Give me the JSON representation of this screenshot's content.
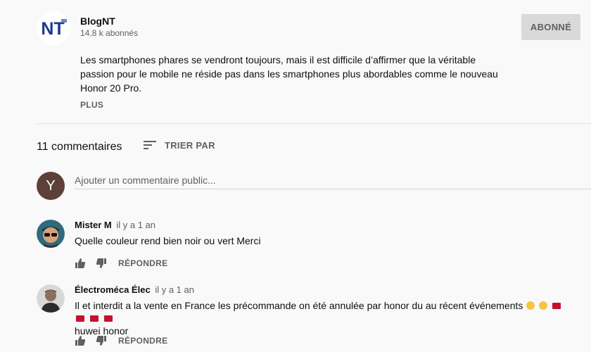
{
  "channel": {
    "logo_text": "NT",
    "name": "BlogNT",
    "subscribers": "14,8 k abonnés",
    "subscribe_label": "ABONNÉ"
  },
  "description": {
    "lines": [
      "Les smartphones phares se vendront toujours, mais il est difficile d’affirmer que la véritable",
      "passion pour le mobile ne réside pas dans les smartphones plus abordables comme le nouveau",
      "Honor 20 Pro."
    ],
    "more_label": "PLUS"
  },
  "comments_header": {
    "count": "11 commentaires",
    "sort_label": "TRIER PAR"
  },
  "add_comment": {
    "avatar_letter": "Y",
    "placeholder": "Ajouter un commentaire public..."
  },
  "comments": [
    {
      "author": "Mister M",
      "time": "il y a 1 an",
      "text": "Quelle couleur rend bien noir ou vert Merci",
      "reply_label": "RÉPONDRE"
    },
    {
      "author": "Électroméca Élec",
      "time": "il y a 1 an",
      "text": "Il et interdit a la vente en France les précommande on été annulée par honor du au récent événements",
      "text_line2": "huwei honor",
      "emoji": [
        "face",
        "face",
        "flag",
        "flag",
        "flag",
        "flag"
      ],
      "reply_label": "RÉPONDRE"
    }
  ],
  "colors": {
    "background": "#f9f9f9",
    "subscribe_bg": "#d9d9d9",
    "user_avatar": "#5d4037",
    "logo_blue": "#1e3a8a"
  }
}
